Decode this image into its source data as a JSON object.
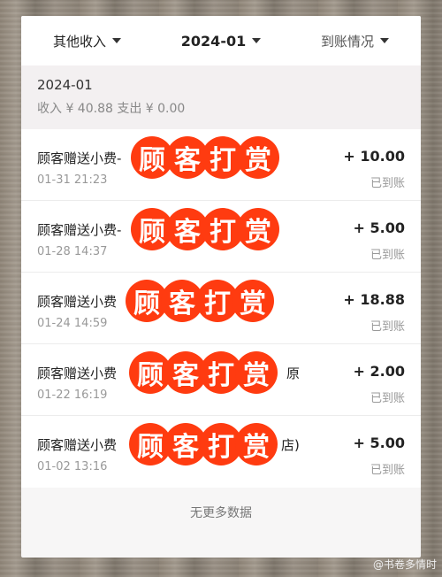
{
  "filters": {
    "type": "其他收入",
    "month": "2024-01",
    "status": "到账情况"
  },
  "summary": {
    "month": "2024-01",
    "totals": "收入 ¥ 40.88 支出 ¥ 0.00"
  },
  "stamp_text": [
    "顾",
    "客",
    "打",
    "赏"
  ],
  "transactions": [
    {
      "title": "顾客赠送小费-",
      "time": "01-31 21:23",
      "amount": "+ 10.00",
      "status": "已到账"
    },
    {
      "title": "顾客赠送小费-",
      "time": "01-28 14:37",
      "amount": "+ 5.00",
      "status": "已到账"
    },
    {
      "title": "顾客赠送小费",
      "time": "01-24 14:59",
      "amount": "+ 18.88",
      "status": "已到账"
    },
    {
      "title": "顾客赠送小费",
      "suffix": "原",
      "time": "01-22 16:19",
      "amount": "+ 2.00",
      "status": "已到账"
    },
    {
      "title": "顾客赠送小费",
      "suffix": "店)",
      "time": "01-02 13:16",
      "amount": "+ 5.00",
      "status": "已到账"
    }
  ],
  "footer": "无更多数据",
  "watermark": "@书卷多情时"
}
